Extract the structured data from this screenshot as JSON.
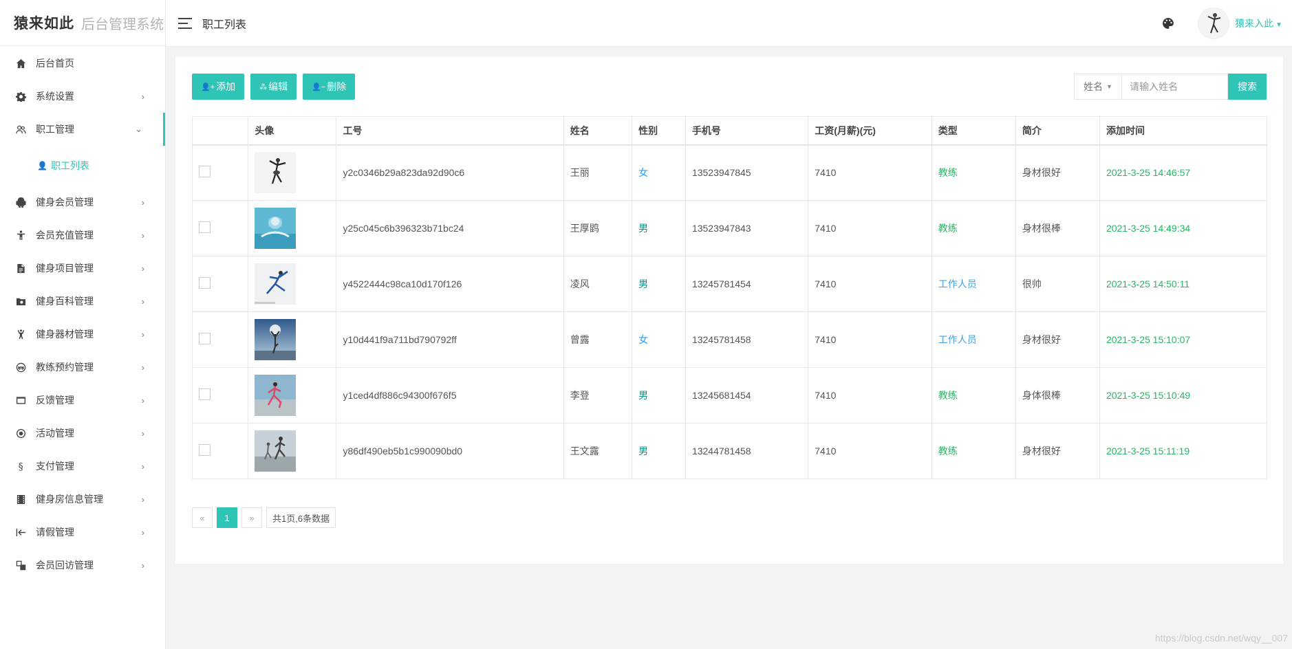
{
  "brand": {
    "name": "猿来如此",
    "subtitle": "后台管理系统"
  },
  "header": {
    "breadcrumb": "职工列表",
    "username": "猿来入此"
  },
  "sidebar": {
    "items": [
      {
        "label": "后台首页",
        "icon": "home-icon",
        "chevron": ""
      },
      {
        "label": "系统设置",
        "icon": "gear-icon",
        "chevron": "›"
      },
      {
        "label": "职工管理",
        "icon": "users-icon",
        "chevron": "⌄",
        "open": true
      },
      {
        "label": "健身会员管理",
        "icon": "android-icon",
        "chevron": "›"
      },
      {
        "label": "会员充值管理",
        "icon": "person-icon",
        "chevron": "›"
      },
      {
        "label": "健身项目管理",
        "icon": "file-icon",
        "chevron": "›"
      },
      {
        "label": "健身百科管理",
        "icon": "folder-icon",
        "chevron": "›"
      },
      {
        "label": "健身器材管理",
        "icon": "fitness-icon",
        "chevron": "›"
      },
      {
        "label": "教练预约管理",
        "icon": "mask-icon",
        "chevron": "›"
      },
      {
        "label": "反馈管理",
        "icon": "window-icon",
        "chevron": "›"
      },
      {
        "label": "活动管理",
        "icon": "target-icon",
        "chevron": "›"
      },
      {
        "label": "支付管理",
        "icon": "section-icon",
        "chevron": "›"
      },
      {
        "label": "健身房信息管理",
        "icon": "film-icon",
        "chevron": "›"
      },
      {
        "label": "请假管理",
        "icon": "arrow-left-bar-icon",
        "chevron": "›"
      },
      {
        "label": "会员回访管理",
        "icon": "object-group-icon",
        "chevron": "›"
      }
    ],
    "submenu": {
      "label": "职工列表"
    }
  },
  "toolbar": {
    "add": "添加",
    "edit": "编辑",
    "delete": "删除"
  },
  "search": {
    "field": "姓名",
    "placeholder": "请输入姓名",
    "button": "搜索"
  },
  "table": {
    "headers": [
      "",
      "头像",
      "工号",
      "姓名",
      "性别",
      "手机号",
      "工资(月薪)(元)",
      "类型",
      "简介",
      "添加时间"
    ],
    "rows": [
      {
        "id": "y2c0346b29a823da92d90c6",
        "name": "王丽",
        "gender": "女",
        "phone": "13523947845",
        "salary": "7410",
        "type": "教练",
        "intro": "身材很好",
        "time": "2021-3-25 14:46:57",
        "avatar": "ballet"
      },
      {
        "id": "y25c045c6b396323b71bc24",
        "name": "王厚鹍",
        "gender": "男",
        "phone": "13523947843",
        "salary": "7410",
        "type": "教练",
        "intro": "身材很棒",
        "time": "2021-3-25 14:49:34",
        "avatar": "swimmer"
      },
      {
        "id": "y4522444c98ca10d170f126",
        "name": "凌风",
        "gender": "男",
        "phone": "13245781454",
        "salary": "7410",
        "type": "工作人员",
        "intro": "很帅",
        "time": "2021-3-25 14:50:11",
        "avatar": "dancer"
      },
      {
        "id": "y10d441f9a711bd790792ff",
        "name": "曾露",
        "gender": "女",
        "phone": "13245781458",
        "salary": "7410",
        "type": "工作人员",
        "intro": "身材很好",
        "time": "2021-3-25 15:10:07",
        "avatar": "yoga"
      },
      {
        "id": "y1ced4df886c94300f676f5",
        "name": "李登",
        "gender": "男",
        "phone": "13245681454",
        "salary": "7410",
        "type": "教练",
        "intro": "身体很棒",
        "time": "2021-3-25 15:10:49",
        "avatar": "runner"
      },
      {
        "id": "y86df490eb5b1c990090bd0",
        "name": "王文露",
        "gender": "男",
        "phone": "13244781458",
        "salary": "7410",
        "type": "教练",
        "intro": "身材很好",
        "time": "2021-3-25 15:11:19",
        "avatar": "runners"
      }
    ]
  },
  "pagination": {
    "prev": "«",
    "current": "1",
    "next": "»",
    "info": "共1页,6条数据"
  },
  "watermark": "https://blog.csdn.net/wqy__007",
  "colors": {
    "accent": "#2ec4b6",
    "female": "#1e9fff",
    "male": "#009688",
    "coach": "#25b864",
    "staff": "#3fa2e0"
  }
}
